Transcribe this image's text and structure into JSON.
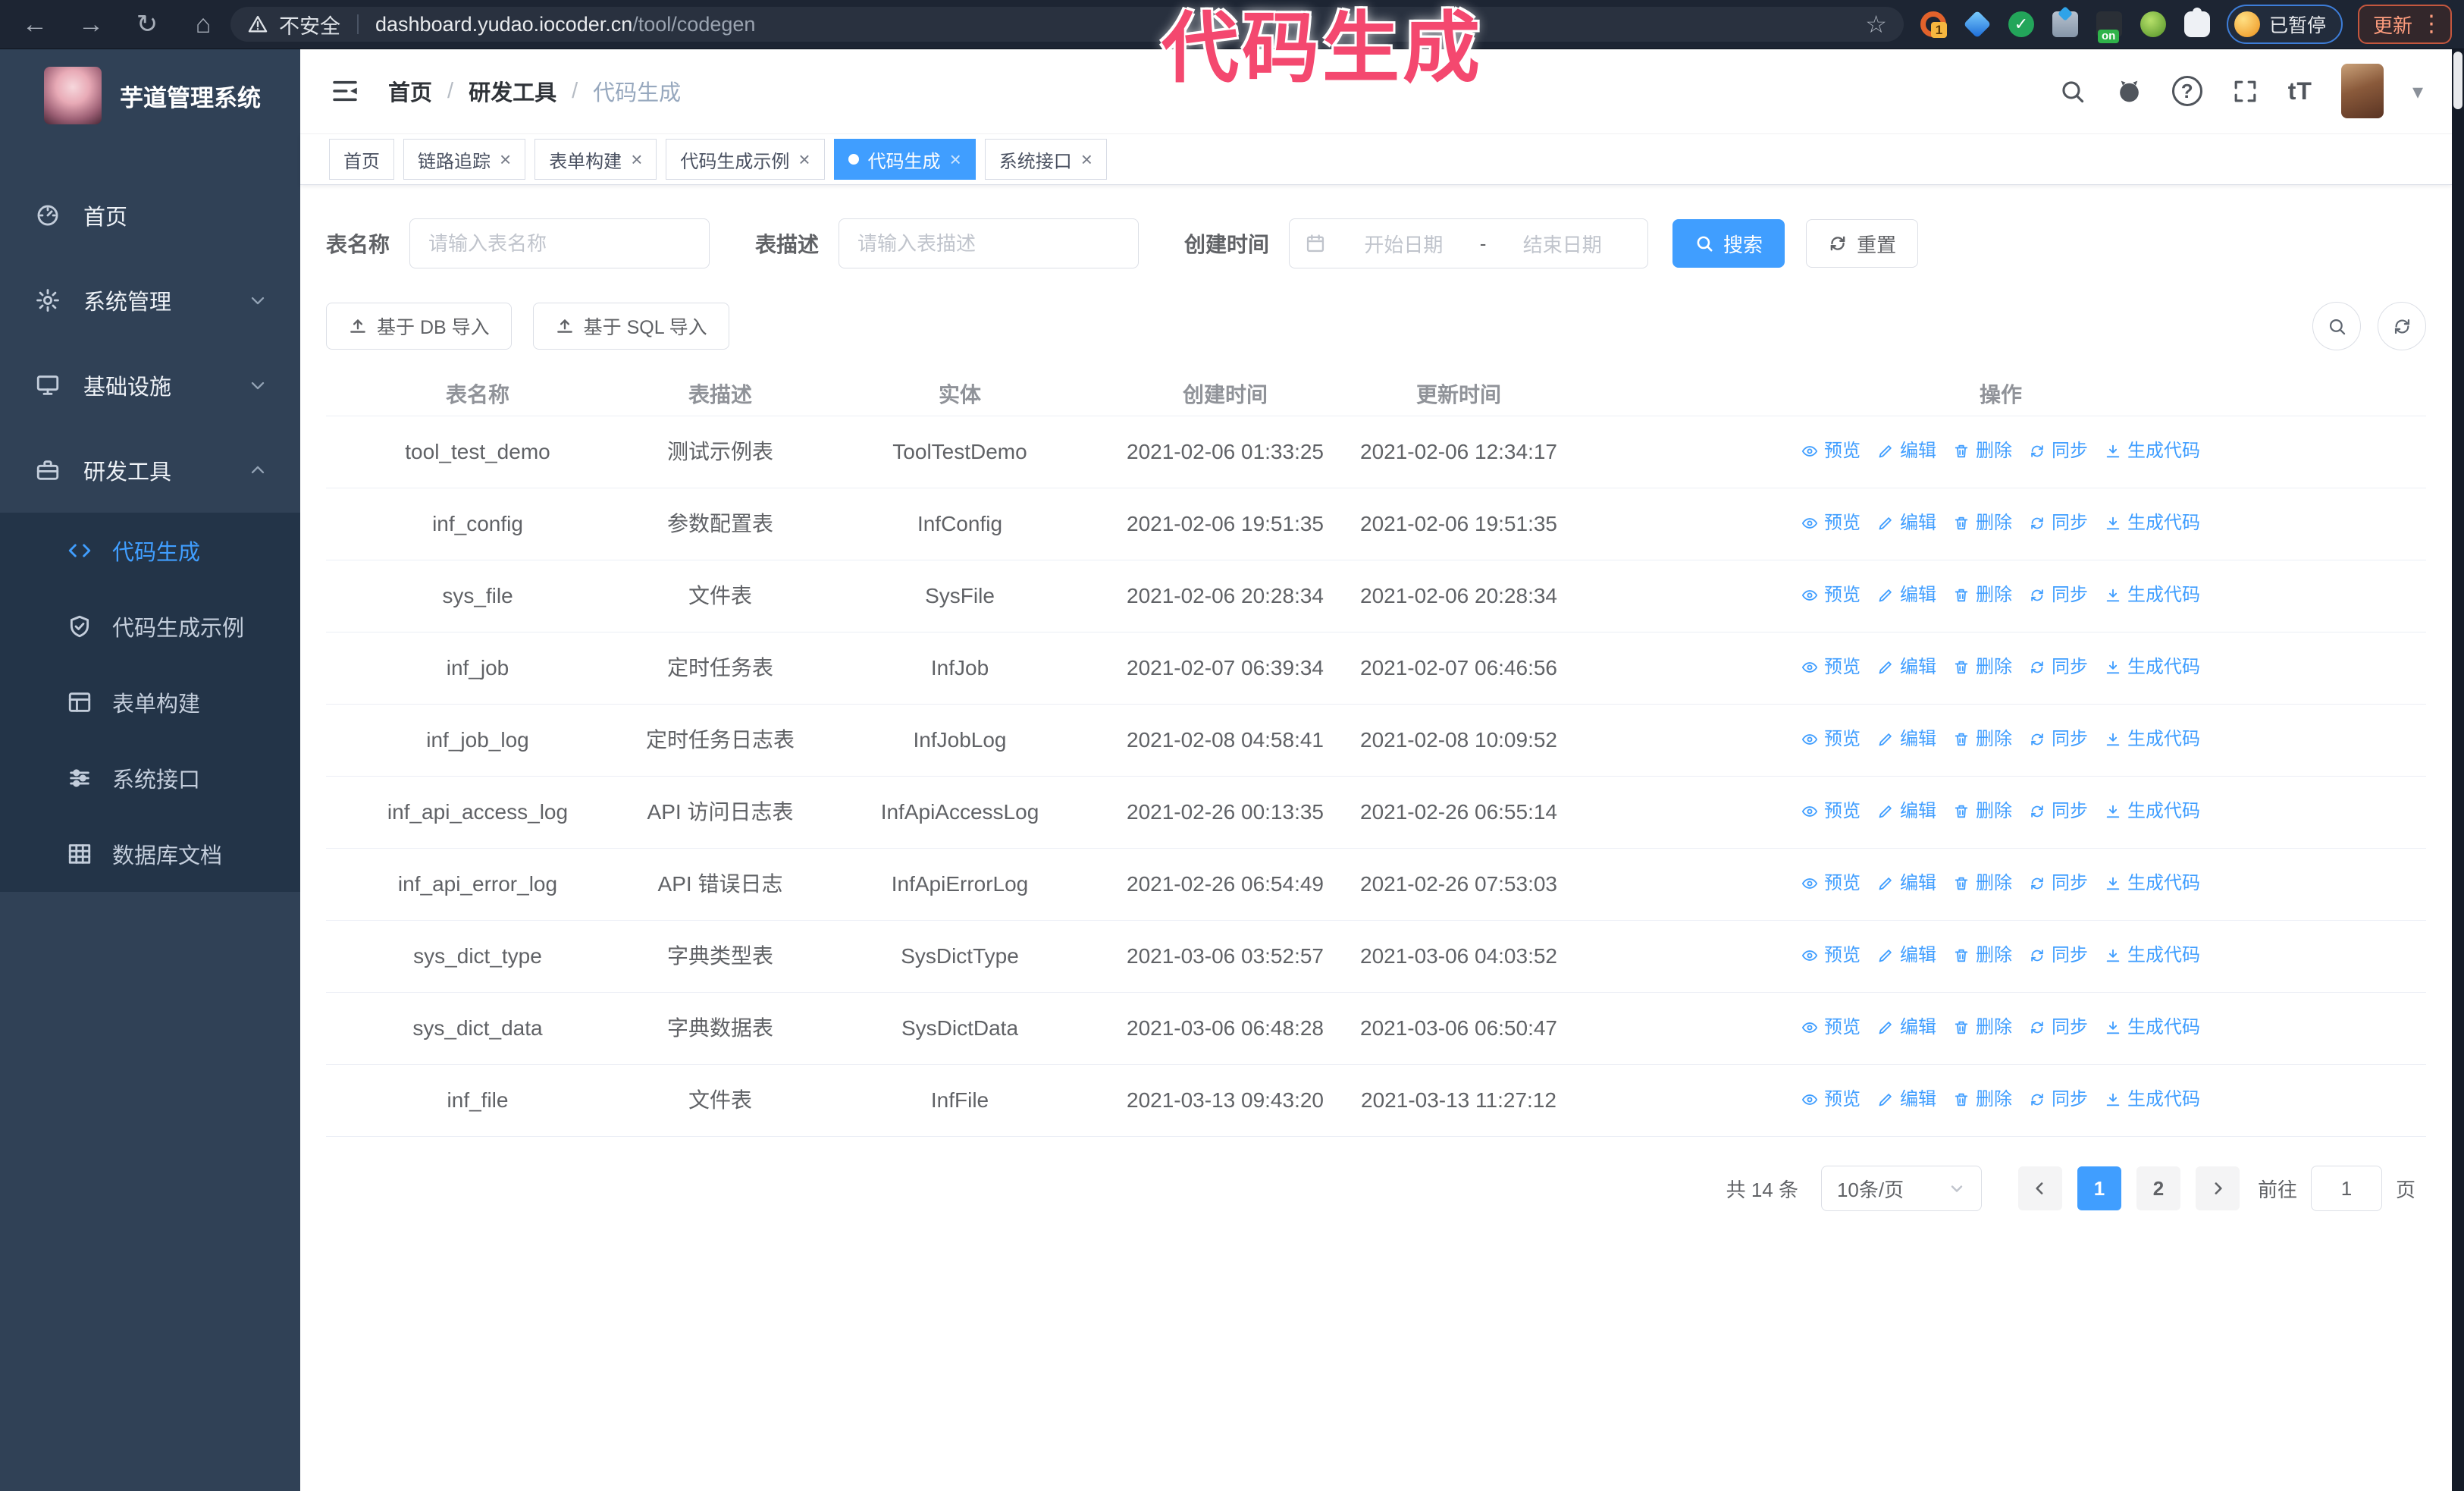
{
  "browser": {
    "security_label": "不安全",
    "url_host": "dashboard.yudao.iocoder.cn",
    "url_path": "/tool/codegen",
    "paused_badge": "已暂停",
    "update_button": "更新",
    "extensions": [
      "orange-ring-icon",
      "blue-gem-icon",
      "green-check-icon",
      "blue-grid-icon",
      "dark-on-badge-icon",
      "green-monkey-icon",
      "white-puzzle-icon"
    ]
  },
  "glyphs": {
    "back": "←",
    "forward": "→",
    "reload": "↻",
    "home": "⌂",
    "star": "☆",
    "kebab": "⋮",
    "caret": "▾",
    "close": "×",
    "help": "?",
    "font_size": "tT"
  },
  "annotation": {
    "text": "代码生成",
    "color": "#f4486f"
  },
  "sidebar": {
    "title": "芋道管理系统",
    "items": [
      {
        "key": "home",
        "label": "首页",
        "icon": "dashboard-icon",
        "chevron": null
      },
      {
        "key": "system",
        "label": "系统管理",
        "icon": "gear-icon",
        "chevron": "down"
      },
      {
        "key": "infra",
        "label": "基础设施",
        "icon": "monitor-icon",
        "chevron": "down"
      },
      {
        "key": "devtools",
        "label": "研发工具",
        "icon": "briefcase-icon",
        "chevron": "up"
      }
    ],
    "submenu": [
      {
        "key": "codegen",
        "label": "代码生成",
        "icon": "code-icon",
        "active": true
      },
      {
        "key": "codegen-example",
        "label": "代码生成示例",
        "icon": "shield-check-icon",
        "active": false
      },
      {
        "key": "form-builder",
        "label": "表单构建",
        "icon": "form-icon",
        "active": false
      },
      {
        "key": "system-api",
        "label": "系统接口",
        "icon": "sliders-icon",
        "active": false
      },
      {
        "key": "db-doc",
        "label": "数据库文档",
        "icon": "table-grid-icon",
        "active": false
      }
    ]
  },
  "breadcrumb": [
    "首页",
    "研发工具",
    "代码生成"
  ],
  "tags": [
    {
      "label": "首页",
      "closable": false,
      "active": false
    },
    {
      "label": "链路追踪",
      "closable": true,
      "active": false
    },
    {
      "label": "表单构建",
      "closable": true,
      "active": false
    },
    {
      "label": "代码生成示例",
      "closable": true,
      "active": false
    },
    {
      "label": "代码生成",
      "closable": true,
      "active": true
    },
    {
      "label": "系统接口",
      "closable": true,
      "active": false
    }
  ],
  "filters": {
    "table_name_label": "表名称",
    "table_name_placeholder": "请输入表名称",
    "table_desc_label": "表描述",
    "table_desc_placeholder": "请输入表描述",
    "create_time_label": "创建时间",
    "date_start_placeholder": "开始日期",
    "date_separator": "-",
    "date_end_placeholder": "结束日期",
    "search_button": "搜索",
    "reset_button": "重置"
  },
  "toolbar": {
    "import_db": "基于 DB 导入",
    "import_sql": "基于 SQL 导入"
  },
  "table": {
    "columns": [
      "表名称",
      "表描述",
      "实体",
      "创建时间",
      "更新时间",
      "操作"
    ],
    "actions": [
      {
        "key": "preview",
        "label": "预览",
        "icon": "eye-icon"
      },
      {
        "key": "edit",
        "label": "编辑",
        "icon": "edit-icon"
      },
      {
        "key": "delete",
        "label": "删除",
        "icon": "delete-icon"
      },
      {
        "key": "sync",
        "label": "同步",
        "icon": "sync-icon"
      },
      {
        "key": "generate",
        "label": "生成代码",
        "icon": "download-icon"
      }
    ],
    "rows": [
      {
        "name": "tool_test_demo",
        "desc": "测试示例表",
        "entity": "ToolTestDemo",
        "created": "2021-02-06 01:33:25",
        "updated": "2021-02-06 12:34:17"
      },
      {
        "name": "inf_config",
        "desc": "参数配置表",
        "entity": "InfConfig",
        "created": "2021-02-06 19:51:35",
        "updated": "2021-02-06 19:51:35"
      },
      {
        "name": "sys_file",
        "desc": "文件表",
        "entity": "SysFile",
        "created": "2021-02-06 20:28:34",
        "updated": "2021-02-06 20:28:34"
      },
      {
        "name": "inf_job",
        "desc": "定时任务表",
        "entity": "InfJob",
        "created": "2021-02-07 06:39:34",
        "updated": "2021-02-07 06:46:56"
      },
      {
        "name": "inf_job_log",
        "desc": "定时任务日志表",
        "entity": "InfJobLog",
        "created": "2021-02-08 04:58:41",
        "updated": "2021-02-08 10:09:52"
      },
      {
        "name": "inf_api_access_log",
        "desc": "API 访问日志表",
        "entity": "InfApiAccessLog",
        "created": "2021-02-26 00:13:35",
        "updated": "2021-02-26 06:55:14"
      },
      {
        "name": "inf_api_error_log",
        "desc": "API 错误日志",
        "entity": "InfApiErrorLog",
        "created": "2021-02-26 06:54:49",
        "updated": "2021-02-26 07:53:03"
      },
      {
        "name": "sys_dict_type",
        "desc": "字典类型表",
        "entity": "SysDictType",
        "created": "2021-03-06 03:52:57",
        "updated": "2021-03-06 04:03:52"
      },
      {
        "name": "sys_dict_data",
        "desc": "字典数据表",
        "entity": "SysDictData",
        "created": "2021-03-06 06:48:28",
        "updated": "2021-03-06 06:50:47"
      },
      {
        "name": "inf_file",
        "desc": "文件表",
        "entity": "InfFile",
        "created": "2021-03-13 09:43:20",
        "updated": "2021-03-13 11:27:12"
      }
    ]
  },
  "pagination": {
    "total_text": "共 14 条",
    "page_size": "10条/页",
    "pages": [
      "1",
      "2"
    ],
    "active_page": "1",
    "goto_label": "前往",
    "goto_value": "1",
    "goto_suffix": "页"
  },
  "colors": {
    "primary": "#409eff",
    "sidebar_bg": "#304156",
    "submenu_bg": "#233448",
    "chrome_bg": "#1d2533",
    "annotation": "#f4486f",
    "table_border": "#ebeef5"
  }
}
